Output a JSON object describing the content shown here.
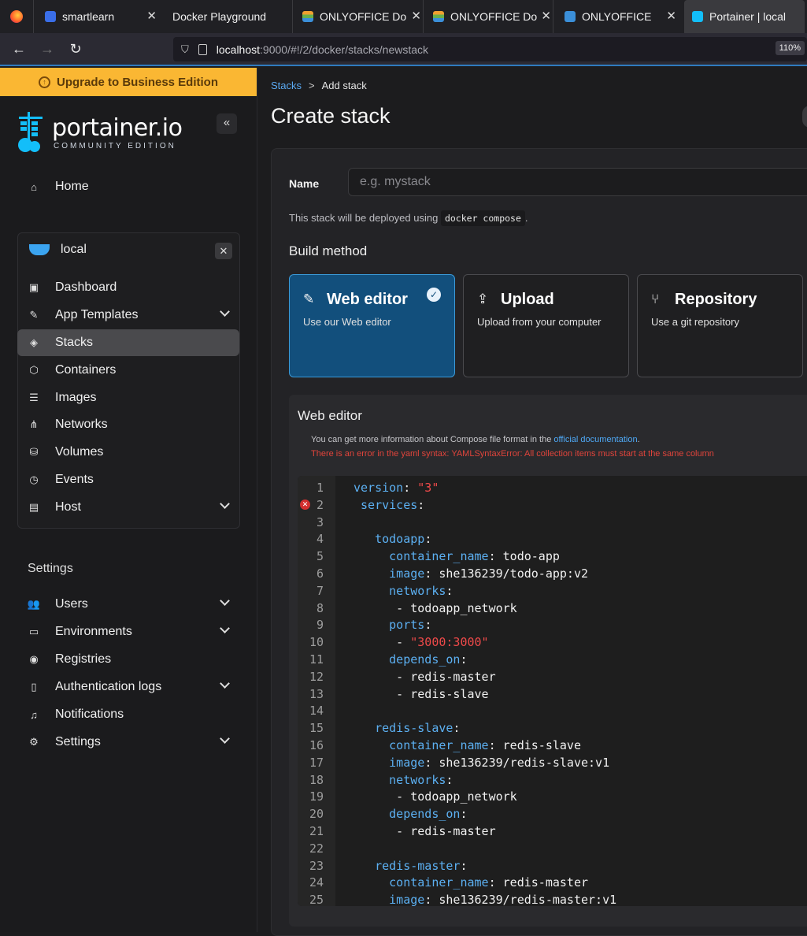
{
  "browser": {
    "tabs": [
      {
        "title": "",
        "icon": "firefox-icon"
      },
      {
        "title": "smartlearn",
        "icon": "smartlearn-icon"
      },
      {
        "title": "Docker Playground",
        "icon": ""
      },
      {
        "title": "ONLYOFFICE Doc",
        "icon": "onlyoffice-icon"
      },
      {
        "title": "ONLYOFFICE Doc",
        "icon": "onlyoffice-icon"
      },
      {
        "title": "ONLYOFFICE",
        "icon": "document-icon"
      },
      {
        "title": "Portainer | local",
        "icon": "portainer-icon"
      }
    ],
    "url_host": "localhost",
    "url_path": ":9000/#!/2/docker/stacks/newstack",
    "zoom": "110%"
  },
  "sidebar": {
    "upgrade_label": "Upgrade to Business Edition",
    "brand_name": "portainer.io",
    "brand_edition": "COMMUNITY EDITION",
    "home_label": "Home",
    "environment": "local",
    "env_items": [
      {
        "label": "Dashboard",
        "icon": "dashboard-icon"
      },
      {
        "label": "App Templates",
        "icon": "edit-icon"
      },
      {
        "label": "Stacks",
        "icon": "layers-icon"
      },
      {
        "label": "Containers",
        "icon": "box-icon"
      },
      {
        "label": "Images",
        "icon": "list-icon"
      },
      {
        "label": "Networks",
        "icon": "share-icon"
      },
      {
        "label": "Volumes",
        "icon": "database-icon"
      },
      {
        "label": "Events",
        "icon": "clock-icon"
      },
      {
        "label": "Host",
        "icon": "host-icon"
      }
    ],
    "settings_heading": "Settings",
    "settings_items": [
      {
        "label": "Users",
        "icon": "users-icon"
      },
      {
        "label": "Environments",
        "icon": "hdd-icon"
      },
      {
        "label": "Registries",
        "icon": "radio-icon"
      },
      {
        "label": "Authentication logs",
        "icon": "file-icon"
      },
      {
        "label": "Notifications",
        "icon": "bell-icon"
      },
      {
        "label": "Settings",
        "icon": "gear-icon"
      }
    ]
  },
  "main": {
    "breadcrumb_link": "Stacks",
    "breadcrumb_sep": ">",
    "breadcrumb_current": "Add stack",
    "page_title": "Create stack",
    "name_label": "Name",
    "name_placeholder": "e.g. mystack",
    "deploy_note_prefix": "This stack will be deployed using",
    "deploy_note_code": "docker compose",
    "deploy_note_suffix": ".",
    "build_method_title": "Build method",
    "build_methods": [
      {
        "name": "Web editor",
        "desc": "Use our Web editor",
        "icon": "edit-icon",
        "selected": true
      },
      {
        "name": "Upload",
        "desc": "Upload from your computer",
        "icon": "upload-icon",
        "selected": false
      },
      {
        "name": "Repository",
        "desc": "Use a git repository",
        "icon": "git-icon",
        "selected": false
      }
    ],
    "web_editor_title": "Web editor",
    "info_prefix": "You can get more information about Compose file format in the",
    "info_link": "official documentation",
    "info_suffix": ".",
    "error_text": "There is an error in the yaml syntax: YAMLSyntaxError: All collection items must start at the same column",
    "editor_lines": [
      [
        {
          "t": "version",
          "c": "k"
        },
        {
          "t": ": "
        },
        {
          "t": "\"3\"",
          "c": "s"
        }
      ],
      [
        {
          "t": " services",
          "c": "k"
        },
        {
          "t": ":"
        }
      ],
      [],
      [
        {
          "t": "   todoapp",
          "c": "k"
        },
        {
          "t": ":"
        }
      ],
      [
        {
          "t": "     container_name",
          "c": "k"
        },
        {
          "t": ": todo-app"
        }
      ],
      [
        {
          "t": "     image",
          "c": "k"
        },
        {
          "t": ": she136239/todo-app:v2"
        }
      ],
      [
        {
          "t": "     networks",
          "c": "k"
        },
        {
          "t": ":"
        }
      ],
      [
        {
          "t": "      - todoapp_network"
        }
      ],
      [
        {
          "t": "     ports",
          "c": "k"
        },
        {
          "t": ":"
        }
      ],
      [
        {
          "t": "      - "
        },
        {
          "t": "\"3000:3000\"",
          "c": "s"
        }
      ],
      [
        {
          "t": "     depends_on",
          "c": "k"
        },
        {
          "t": ":"
        }
      ],
      [
        {
          "t": "      - redis-master"
        }
      ],
      [
        {
          "t": "      - redis-slave"
        }
      ],
      [],
      [
        {
          "t": "   redis-slave",
          "c": "k"
        },
        {
          "t": ":"
        }
      ],
      [
        {
          "t": "     container_name",
          "c": "k"
        },
        {
          "t": ": redis-slave"
        }
      ],
      [
        {
          "t": "     image",
          "c": "k"
        },
        {
          "t": ": she136239/redis-slave:v1"
        }
      ],
      [
        {
          "t": "     networks",
          "c": "k"
        },
        {
          "t": ":"
        }
      ],
      [
        {
          "t": "      - todoapp_network"
        }
      ],
      [
        {
          "t": "     depends_on",
          "c": "k"
        },
        {
          "t": ":"
        }
      ],
      [
        {
          "t": "      - redis-master"
        }
      ],
      [],
      [
        {
          "t": "   redis-master",
          "c": "k"
        },
        {
          "t": ":"
        }
      ],
      [
        {
          "t": "     container_name",
          "c": "k"
        },
        {
          "t": ": redis-master"
        }
      ],
      [
        {
          "t": "     image",
          "c": "k"
        },
        {
          "t": ": she136239/redis-master:v1"
        }
      ]
    ],
    "error_line": 2
  },
  "colors": {
    "upgrade_bg": "#fab733",
    "selected_card_bg": "#124f7c",
    "link": "#5aa8f0",
    "error": "#e0443b",
    "yaml_key": "#5cb0f2",
    "yaml_string": "#f04a4a"
  }
}
